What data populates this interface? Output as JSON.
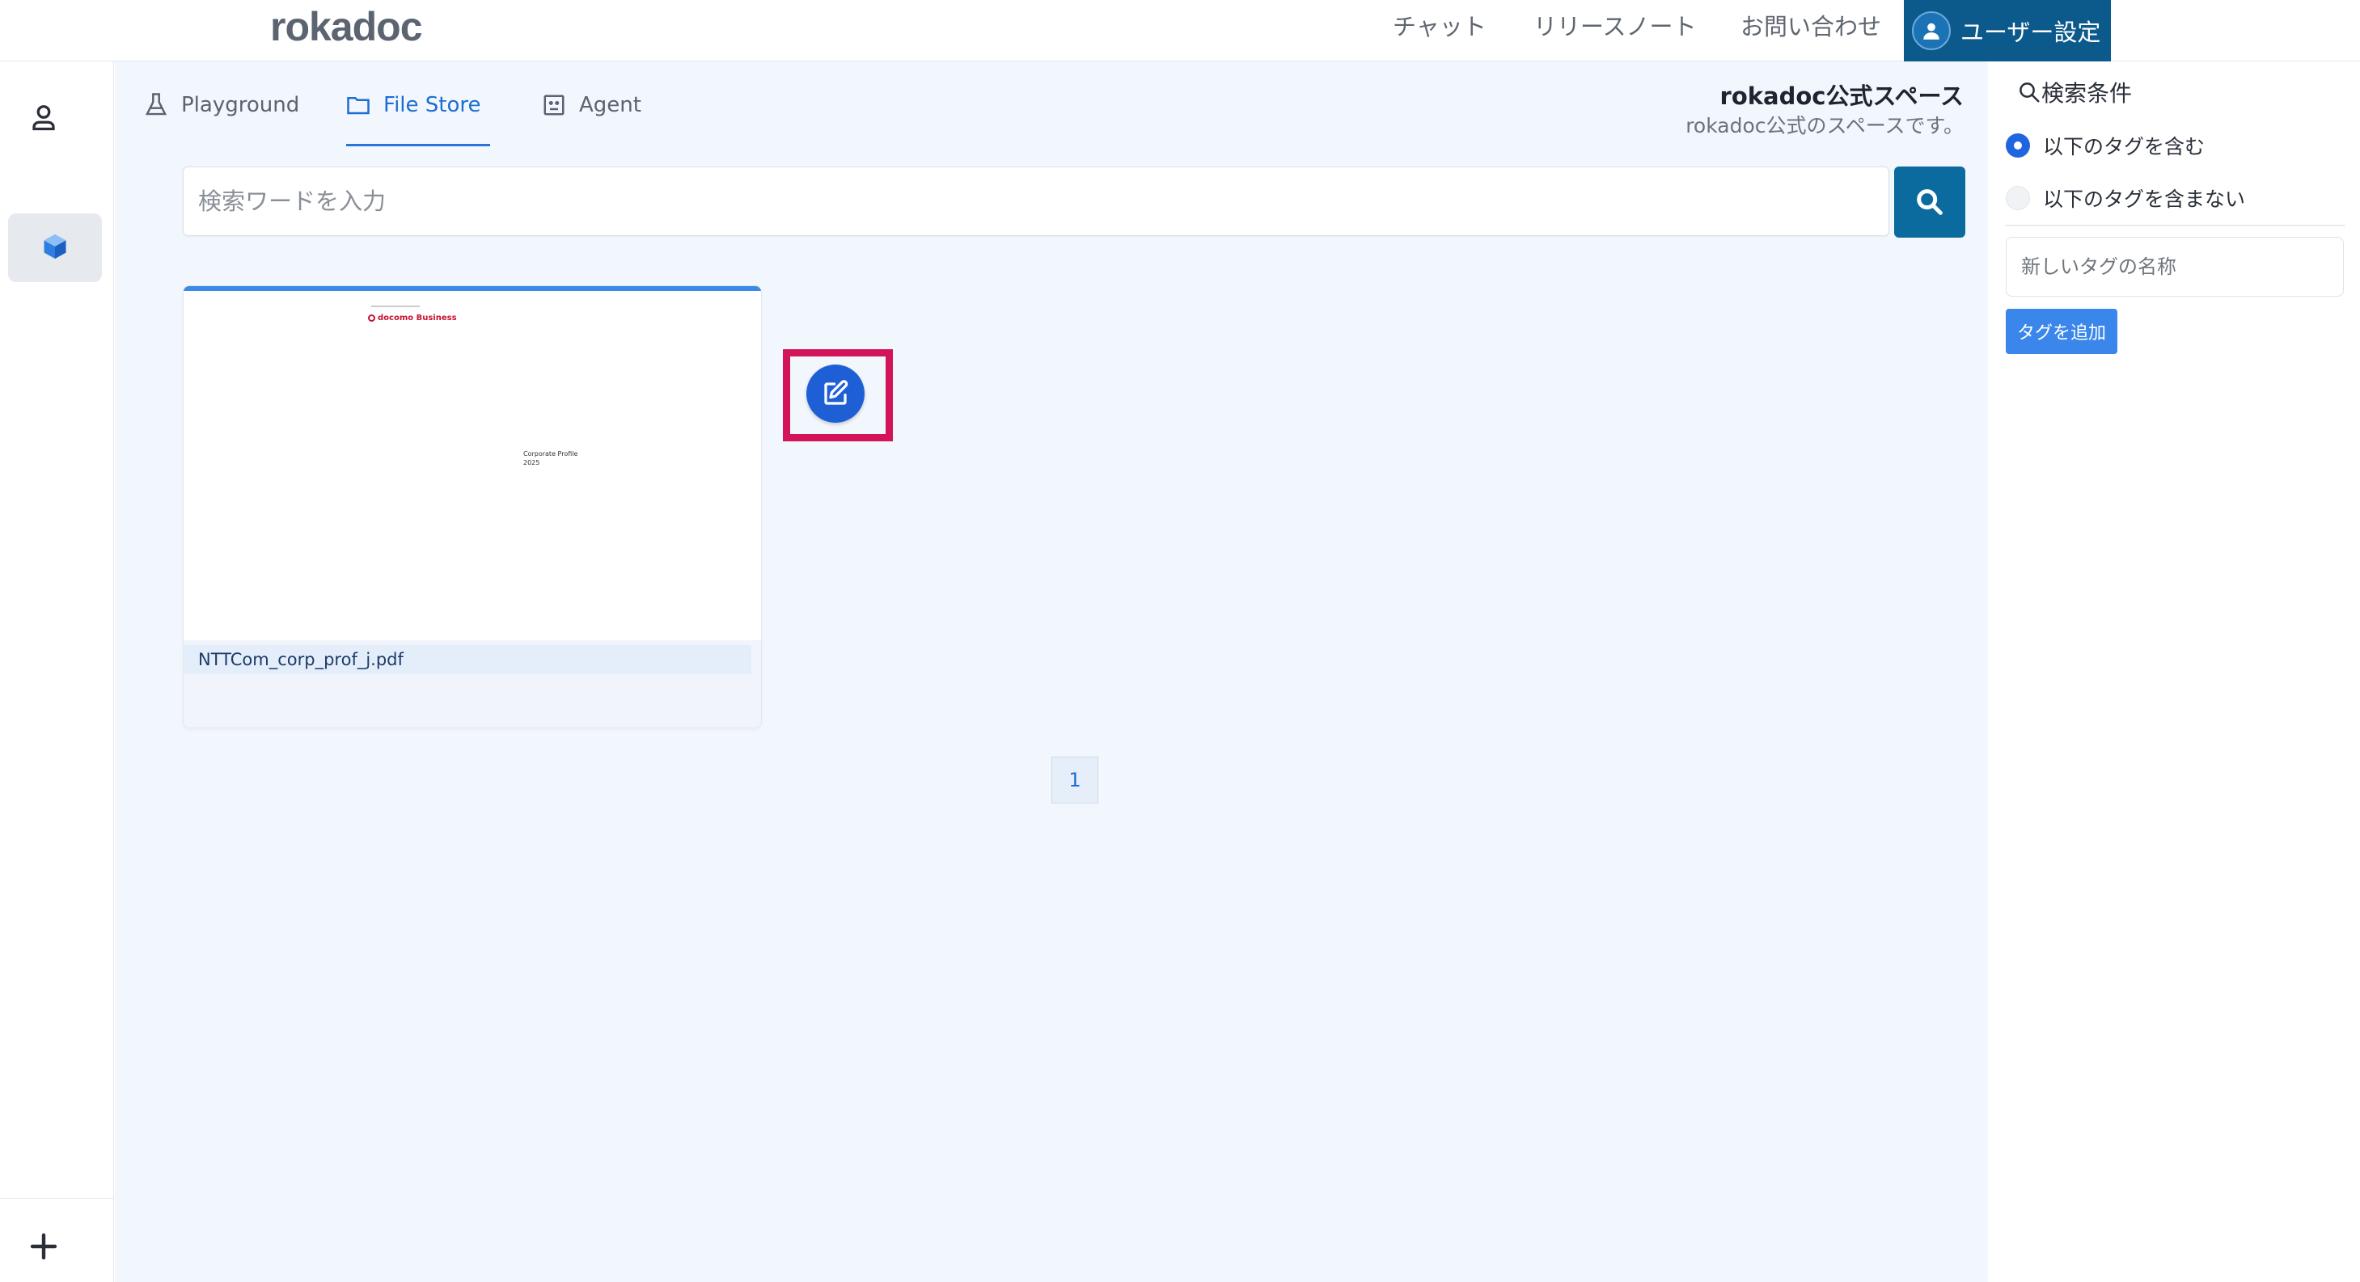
{
  "header": {
    "brand": "rokadoc",
    "nav": [
      {
        "label": "チャット"
      },
      {
        "label": "リリースノート"
      },
      {
        "label": "お問い合わせ"
      }
    ],
    "user_settings_label": "ユーザー設定"
  },
  "rail": {
    "icons": [
      "user-icon",
      "cube-icon",
      "plus-icon"
    ]
  },
  "tabs": [
    {
      "label": "Playground",
      "icon": "flask-icon",
      "active": false
    },
    {
      "label": "File Store",
      "icon": "folder-icon",
      "active": true
    },
    {
      "label": "Agent",
      "icon": "agent-icon",
      "active": false
    }
  ],
  "space": {
    "name": "rokadoc公式スペース",
    "description": "rokadoc公式のスペースです。"
  },
  "search": {
    "placeholder": "検索ワードを入力",
    "value": ""
  },
  "files": [
    {
      "filename": "NTTCom_corp_prof_j.pdf",
      "thumbnail": {
        "logo_text": "docomo Business",
        "title_lines": [
          "Corporate Profile",
          "2025"
        ]
      }
    }
  ],
  "pagination": {
    "current": "1"
  },
  "filter_panel": {
    "title": "検索条件",
    "options": [
      {
        "label": "以下のタグを含む",
        "selected": true
      },
      {
        "label": "以下のタグを含まない",
        "selected": false
      }
    ],
    "tag_input_placeholder": "新しいタグの名称",
    "add_tag_label": "タグを追加"
  },
  "colors": {
    "accent": "#1d6dd4",
    "user_button": "#0c5a8c",
    "search_button": "#0b6a9e",
    "highlight": "#d4145a",
    "edit_button": "#1f5fd6"
  }
}
